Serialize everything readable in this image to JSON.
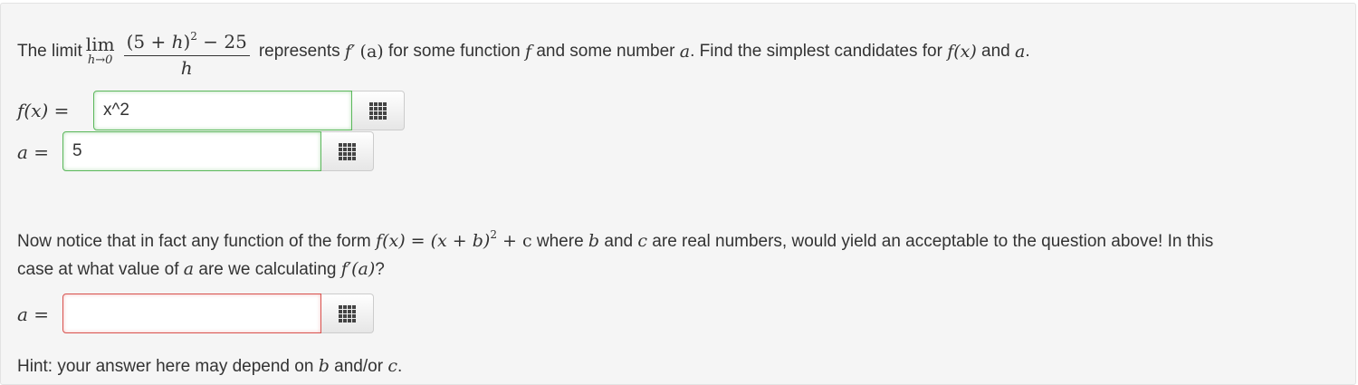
{
  "question1": {
    "intro": "The limit",
    "lim": "lim",
    "lim_sub": "h→0",
    "numerator_open": "(5 + ",
    "numerator_h": "h",
    "numerator_close": ")",
    "numerator_exp": "2",
    "numerator_tail": " − 25",
    "denominator": "h",
    "text_represents": "represents",
    "f_prime": "f′",
    "paren_a": "(a)",
    "text_for_some_function": "for some function",
    "f": "f",
    "text_and_some_number": "and some number",
    "a": "a",
    "text_find": ". Find the simplest candidates for",
    "fx": "f(x)",
    "text_and": "and",
    "a_end": "a",
    "period": "."
  },
  "answers": {
    "fx_label": "f(x) =",
    "fx_value": "x^2",
    "fx_status": "correct",
    "a_label": "a =",
    "a_value": "5",
    "a_status": "correct"
  },
  "question2": {
    "text1": "Now notice that in fact any function of the form",
    "form_lhs": "f(x) = (x + b)",
    "form_exp": "2",
    "form_rhs": " + c",
    "text2": "where",
    "b": "b",
    "text3": "and",
    "c": "c",
    "text4": "are real numbers, would yield an acceptable to the question above! In this",
    "line2_text1": "case at what value of",
    "a": "a",
    "line2_text2": "are we calculating",
    "fpa": "f′(a)",
    "line2_end": "?"
  },
  "answer3": {
    "label": "a =",
    "value": "",
    "status": "incorrect"
  },
  "hint": {
    "text1": "Hint: your answer here may depend on",
    "b": "b",
    "text2": "and/or",
    "c": "c",
    "end": "."
  },
  "icons": {
    "palette": "grid-icon"
  },
  "colors": {
    "correct_border": "#5cb85c",
    "incorrect_border": "#d9534f",
    "panel_bg": "#f5f5f5"
  }
}
